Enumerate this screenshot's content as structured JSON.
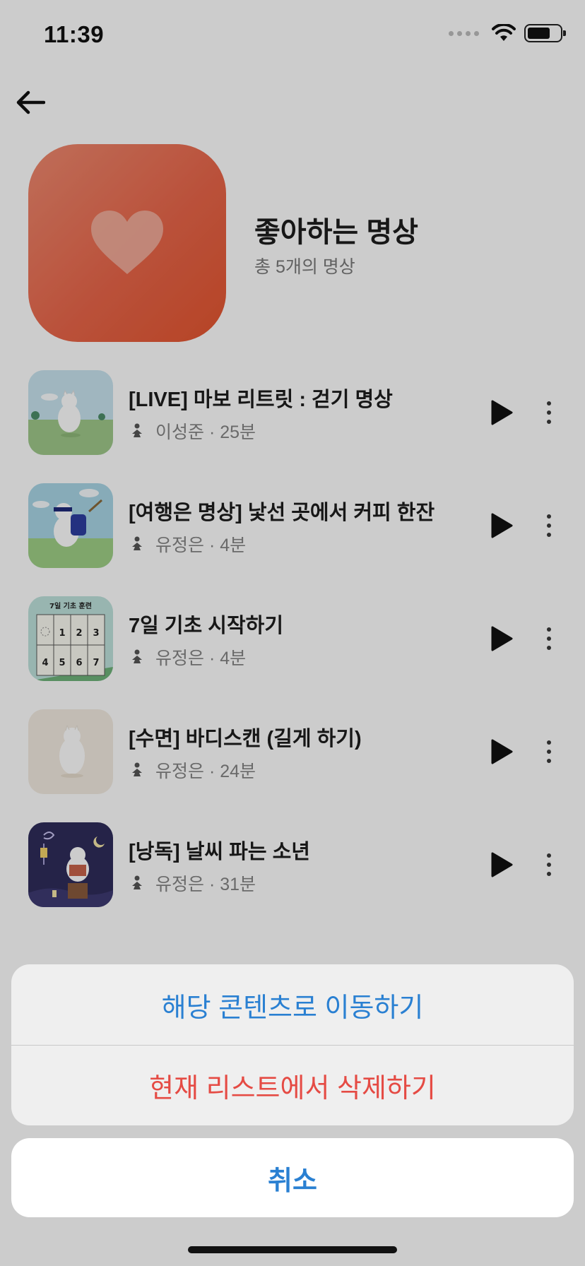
{
  "status_bar": {
    "time": "11:39"
  },
  "header": {
    "title": "좋아하는 명상",
    "subtitle": "총 5개의 명상"
  },
  "items": [
    {
      "title": "[LIVE] 마보 리트릿 : 걷기 명상",
      "author": "이성준 · 25분"
    },
    {
      "title": "[여행은 명상] 낯선 곳에서 커피 한잔",
      "author": "유정은 · 4분"
    },
    {
      "title": "7일 기초 시작하기",
      "author": "유정은 · 4분"
    },
    {
      "title": "[수면] 바디스캔 (길게 하기)",
      "author": "유정은 · 24분"
    },
    {
      "title": "[낭독] 날씨 파는 소년",
      "author": "유정은 · 31분"
    }
  ],
  "thumbnail_texts": {
    "grid_title": "7일 기초 훈련",
    "grid_numbers": [
      "1",
      "2",
      "3",
      "4",
      "5",
      "6",
      "7"
    ]
  },
  "action_sheet": {
    "go_label": "해당 콘텐츠로 이동하기",
    "delete_label": "현재 리스트에서 삭제하기",
    "cancel_label": "취소"
  },
  "colors": {
    "accent_blue": "#2a80d2",
    "destructive_red": "#e54b44",
    "hero": "#e9664a"
  }
}
